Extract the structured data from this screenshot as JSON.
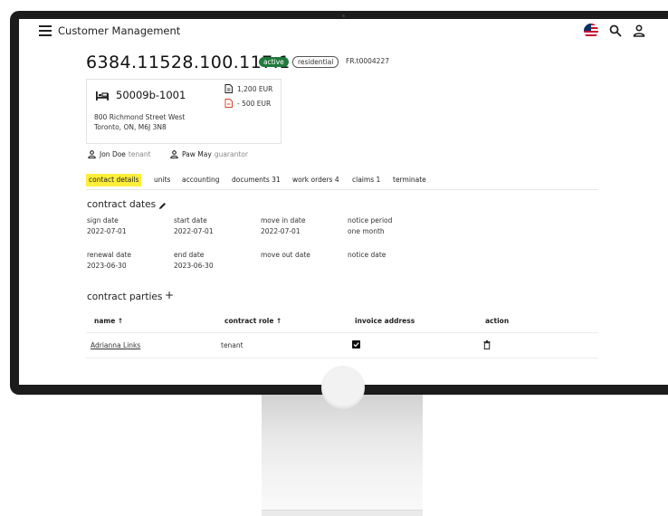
{
  "header": {
    "title": "Customer Management",
    "icons": [
      "menu-icon",
      "flag-icon",
      "search-icon",
      "user-icon"
    ]
  },
  "record": {
    "id": "6384.11528.100.117.1",
    "status_badge": "active",
    "type_badge": "residential",
    "ref": "FR.t0004227"
  },
  "unit": {
    "code": "50009b-1001",
    "address_line1": "800 Richmond Street West",
    "address_line2": "Toronto, ON, M6J 3N8",
    "amount_positive": "1,200 EUR",
    "amount_negative": "- 500 EUR"
  },
  "persons": [
    {
      "name": "Jon Doe",
      "role": "tenant"
    },
    {
      "name": "Paw May",
      "role": "guarantor"
    }
  ],
  "tabs": [
    {
      "label": "contact details",
      "active": true
    },
    {
      "label": "units"
    },
    {
      "label": "accounting"
    },
    {
      "label": "documents 31"
    },
    {
      "label": "work orders 4"
    },
    {
      "label": "claims 1"
    },
    {
      "label": "terminate"
    }
  ],
  "contract_dates": {
    "title": "contract dates",
    "fields": [
      {
        "label": "sign date",
        "value": "2022-07-01"
      },
      {
        "label": "start date",
        "value": "2022-07-01"
      },
      {
        "label": "move in date",
        "value": "2022-07-01"
      },
      {
        "label": "notice period",
        "value": "one month"
      },
      {
        "label": "renewal date",
        "value": "2023-06-30"
      },
      {
        "label": "end date",
        "value": "2023-06-30"
      },
      {
        "label": "move out date",
        "value": ""
      },
      {
        "label": "notice date",
        "value": ""
      }
    ]
  },
  "contract_parties": {
    "title": "contract parties",
    "add_label": "+",
    "columns": [
      "name ↑",
      "contract role ↑",
      "invoice address",
      "action"
    ],
    "rows": [
      {
        "name": "Adrianna Links",
        "role": "tenant",
        "invoice_address": true
      }
    ]
  },
  "colors": {
    "active_badge": "#1f7a3c",
    "active_tab_highlight": "#ffef3a",
    "negative_doc": "#d9452b"
  }
}
